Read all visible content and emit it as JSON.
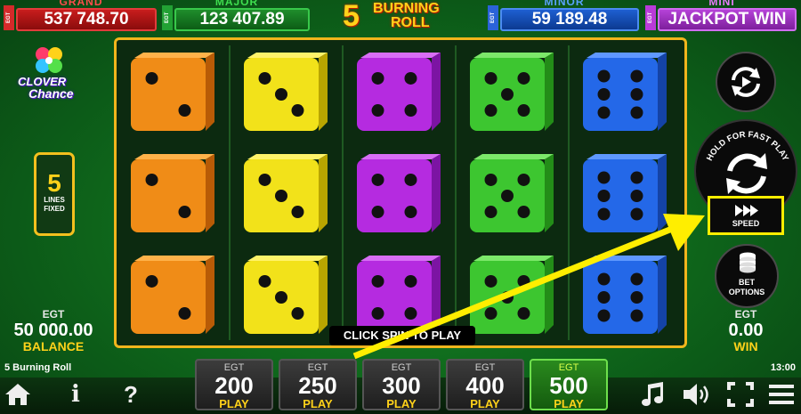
{
  "jackpots": {
    "grand": {
      "title": "GRAND",
      "tag": "EGT",
      "value": "537 748.70"
    },
    "major": {
      "title": "MAJOR",
      "tag": "EGT",
      "value": "123 407.89"
    },
    "minor": {
      "title": "MINOR",
      "tag": "EGT",
      "value": "59 189.48"
    },
    "mini": {
      "title": "MINI",
      "tag": "EGT",
      "value": "JACKPOT WIN"
    }
  },
  "game_title": {
    "number": "5",
    "line1": "BURNING",
    "line2": "ROLL"
  },
  "logo": {
    "line1": "CLOVER",
    "line2": "Chance"
  },
  "lines_box": {
    "number": "5",
    "line1": "LINES",
    "line2": "FIXED"
  },
  "reels": [
    {
      "color": "orange",
      "face": "#f08c17",
      "side": "#b85b06",
      "top": "#ffb24a",
      "pips": [
        2,
        2,
        2
      ]
    },
    {
      "color": "yellow",
      "face": "#f2e21a",
      "side": "#b9a500",
      "top": "#fff36a",
      "pips": [
        3,
        3,
        3
      ]
    },
    {
      "color": "purple",
      "face": "#b52be0",
      "side": "#7c14a3",
      "top": "#d86ef5",
      "pips": [
        4,
        4,
        4
      ]
    },
    {
      "color": "green",
      "face": "#3dc630",
      "side": "#238d18",
      "top": "#7ce86a",
      "pips": [
        5,
        5,
        5
      ]
    },
    {
      "color": "blue",
      "face": "#2468e8",
      "side": "#1443a6",
      "top": "#5f98ff",
      "pips": [
        6,
        6,
        6
      ]
    }
  ],
  "status_message": "CLICK SPIN TO PLAY",
  "balance": {
    "currency": "EGT",
    "amount": "50 000.00",
    "label": "BALANCE"
  },
  "win": {
    "currency": "EGT",
    "amount": "0.00",
    "label": "WIN"
  },
  "buttons": {
    "hold_text": "HOLD FOR FAST PLAY",
    "speed_label": "SPEED",
    "bet_options_line1": "BET",
    "bet_options_line2": "OPTIONS"
  },
  "bets": [
    {
      "currency": "EGT",
      "value": "200",
      "label": "PLAY",
      "active": false
    },
    {
      "currency": "EGT",
      "value": "250",
      "label": "PLAY",
      "active": false
    },
    {
      "currency": "EGT",
      "value": "300",
      "label": "PLAY",
      "active": false
    },
    {
      "currency": "EGT",
      "value": "400",
      "label": "PLAY",
      "active": false
    },
    {
      "currency": "EGT",
      "value": "500",
      "label": "PLAY",
      "active": true
    }
  ],
  "footer": {
    "game_name": "5 Burning Roll",
    "clock": "13:00"
  },
  "icons": {
    "home": "home-icon",
    "info": "info-icon",
    "help": "help-icon",
    "music": "music-icon",
    "sound": "sound-icon",
    "fullscreen": "fullscreen-icon",
    "menu": "menu-icon"
  },
  "colors": {
    "accent_gold": "#f1b51c",
    "highlight": "#ffee00",
    "play_label": "#ffd21a"
  }
}
